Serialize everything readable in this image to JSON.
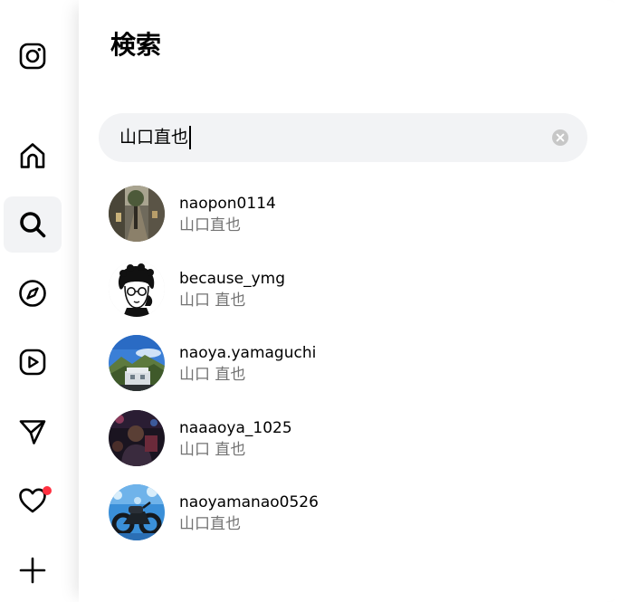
{
  "colors": {
    "search_bg": "#f2f3f5",
    "secondary_text": "#737373",
    "notification_dot": "#ff3040",
    "active_nav_bg": "#f2f3f5"
  },
  "nav": {
    "items": [
      {
        "name": "instagram-logo-icon",
        "active": false
      },
      {
        "name": "home-icon",
        "active": false
      },
      {
        "name": "search-icon",
        "active": true
      },
      {
        "name": "explore-compass-icon",
        "active": false
      },
      {
        "name": "reels-icon",
        "active": false
      },
      {
        "name": "messages-send-icon",
        "active": false
      },
      {
        "name": "notifications-heart-icon",
        "active": false,
        "has_badge": true
      },
      {
        "name": "create-plus-icon",
        "active": false
      }
    ]
  },
  "search_panel": {
    "title": "検索",
    "query": "山口直也",
    "clear_icon": "clear-circle-icon"
  },
  "results": [
    {
      "username": "naopon0114",
      "full_name": "山口直也",
      "avatar": "street-photo"
    },
    {
      "username": "because_ymg",
      "full_name": "山口 直也",
      "avatar": "illustration-portrait"
    },
    {
      "username": "naoya.yamaguchi",
      "full_name": "山口 直也",
      "avatar": "mountain-sky-photo"
    },
    {
      "username": "naaaoya_1025",
      "full_name": "山口 直也",
      "avatar": "dark-night-photo"
    },
    {
      "username": "naoyamanao0526",
      "full_name": "山口直也",
      "avatar": "motorcycle-blue-photo"
    }
  ]
}
